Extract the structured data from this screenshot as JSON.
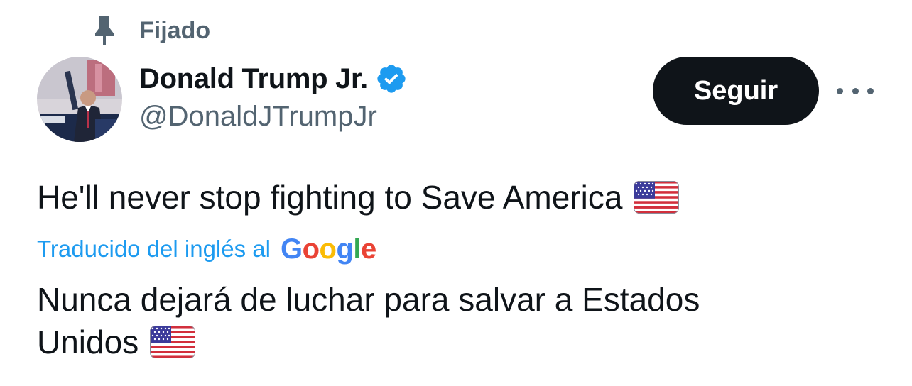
{
  "pinned": {
    "icon": "pin-icon",
    "label": "Fijado"
  },
  "author": {
    "display_name": "Donald Trump Jr.",
    "handle": "@DonaldJTrumpJr",
    "verified": true,
    "verified_icon": "verified-badge-icon",
    "verified_color": "#1d9bf0"
  },
  "actions": {
    "follow_label": "Seguir",
    "more_icon": "more-options-icon"
  },
  "tweet": {
    "text": "He'll never stop fighting to Save America",
    "emoji": "flag-us-icon"
  },
  "translation": {
    "label": "Traducido del inglés al",
    "provider": {
      "letters": [
        "G",
        "o",
        "o",
        "g",
        "l",
        "e"
      ],
      "colors": [
        "#4285f4",
        "#ea4335",
        "#fbbc05",
        "#4285f4",
        "#34a853",
        "#ea4335"
      ]
    },
    "line1": "Nunca dejará de luchar para salvar a Estados",
    "line2": "Unidos"
  },
  "colors": {
    "text": "#0f1419",
    "secondary": "#536471",
    "accent": "#1d9bf0",
    "button_bg": "#0f1419"
  }
}
